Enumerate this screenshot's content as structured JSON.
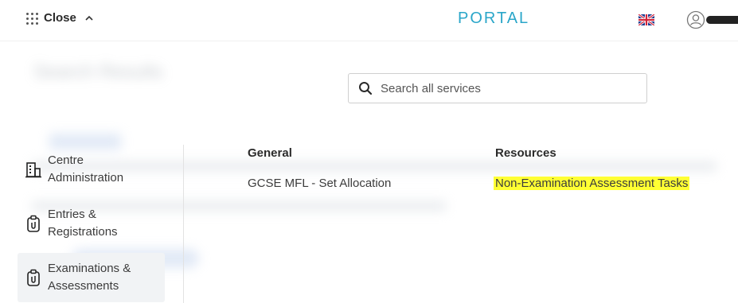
{
  "header": {
    "close_label": "Close",
    "portal_title": "PORTAL",
    "icons": [
      "apps-grid-icon",
      "chevron-up-icon",
      "uk-flag-icon",
      "user-avatar-icon"
    ]
  },
  "background": {
    "title": "Search Results"
  },
  "search": {
    "placeholder": "Search all services"
  },
  "menu": {
    "items": [
      {
        "label": "Centre Administration",
        "icon": "building-icon",
        "active": false
      },
      {
        "label": "Entries & Registrations",
        "icon": "clipboard-icon",
        "active": false
      },
      {
        "label": "Examinations & Assessments",
        "icon": "clipboard-icon",
        "active": true
      }
    ]
  },
  "columns": {
    "general": {
      "heading": "General",
      "links": [
        "GCSE MFL - Set Allocation"
      ]
    },
    "resources": {
      "heading": "Resources",
      "links": [
        "Non-Examination Assessment Tasks"
      ]
    }
  },
  "colors": {
    "brand": "#2aa6c9",
    "highlight": "#ffff33",
    "active_bg": "#f1f3f5"
  }
}
